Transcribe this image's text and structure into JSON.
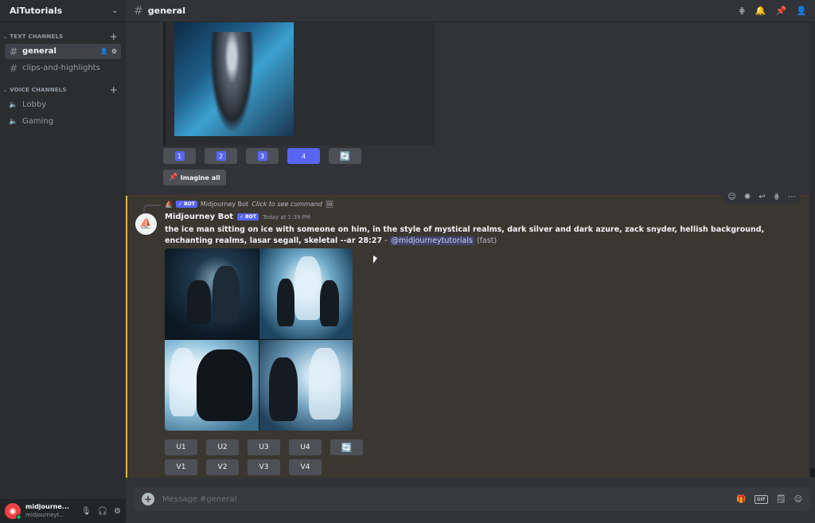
{
  "server": {
    "name": "AiTutorials"
  },
  "sidebar": {
    "text_category": "TEXT CHANNELS",
    "voice_category": "VOICE CHANNELS",
    "text_channels": [
      {
        "label": "general",
        "active": true
      },
      {
        "label": "clips-and-highlights",
        "active": false
      }
    ],
    "voice_channels": [
      {
        "label": "Lobby"
      },
      {
        "label": "Gaming"
      }
    ]
  },
  "user": {
    "name": "midjourne...",
    "status": "midjourneyt..."
  },
  "topbar": {
    "channel": "general"
  },
  "previous_message": {
    "buttons": [
      "1",
      "2",
      "3",
      "4"
    ],
    "selected": "4",
    "imagine_all": "Imagine all"
  },
  "message": {
    "reply": {
      "bot_tag": "✓ BOT",
      "author": "Midjourney Bot",
      "hint": "Click to see command"
    },
    "author": "Midjourney Bot",
    "bot_tag": "✓ BOT",
    "timestamp": "Today at 1:39 PM",
    "prompt": "the ice man sitting on ice with someone on him, in the style of mystical realms, dark silver and dark azure, zack snyder, hellish background, enchanting realms, lasar segall, skeletal --ar 28:27",
    "separator": " - ",
    "mention": "@midjourneytutorials",
    "speed": "(fast)",
    "upscale_buttons": [
      "U1",
      "U2",
      "U3",
      "U4"
    ],
    "variation_buttons": [
      "V1",
      "V2",
      "V3",
      "V4"
    ]
  },
  "composer": {
    "placeholder": "Message #general"
  },
  "colors": {
    "accent": "#5865f2",
    "highlight_border": "#f0b232",
    "mention": "#c9cdfb"
  }
}
